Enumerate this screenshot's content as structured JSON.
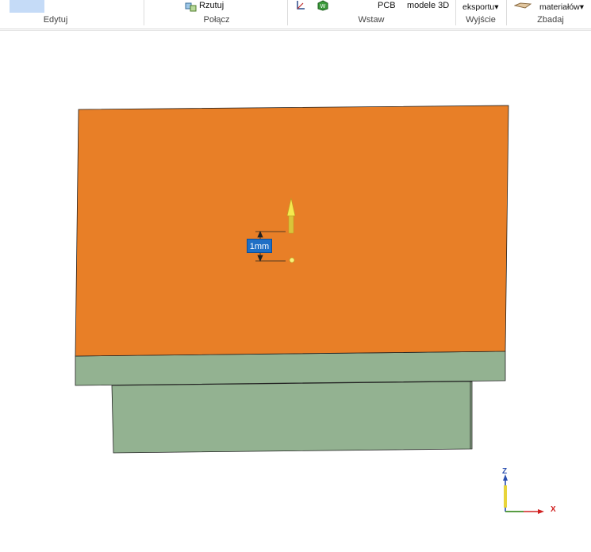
{
  "ribbon": {
    "groups": [
      {
        "label": "Edytuj"
      },
      {
        "label": "Połącz"
      },
      {
        "label": "Wstaw"
      },
      {
        "label": "Wyjście"
      },
      {
        "label": "Zbadaj"
      }
    ],
    "buttons": {
      "rzutuj": "Rzutuj",
      "pcb": "PCB",
      "modele3d": "modele 3D",
      "eksportu": "eksportu▾",
      "materialow": "materiałów▾"
    }
  },
  "viewport": {
    "dimension_value": "1mm",
    "triad": {
      "z": "Z",
      "x": "X"
    },
    "colors": {
      "top_face": "#e87f27",
      "side_face": "#93b291",
      "pull_arrow": "#f2e24a",
      "selection": "#1f6fc5"
    }
  }
}
